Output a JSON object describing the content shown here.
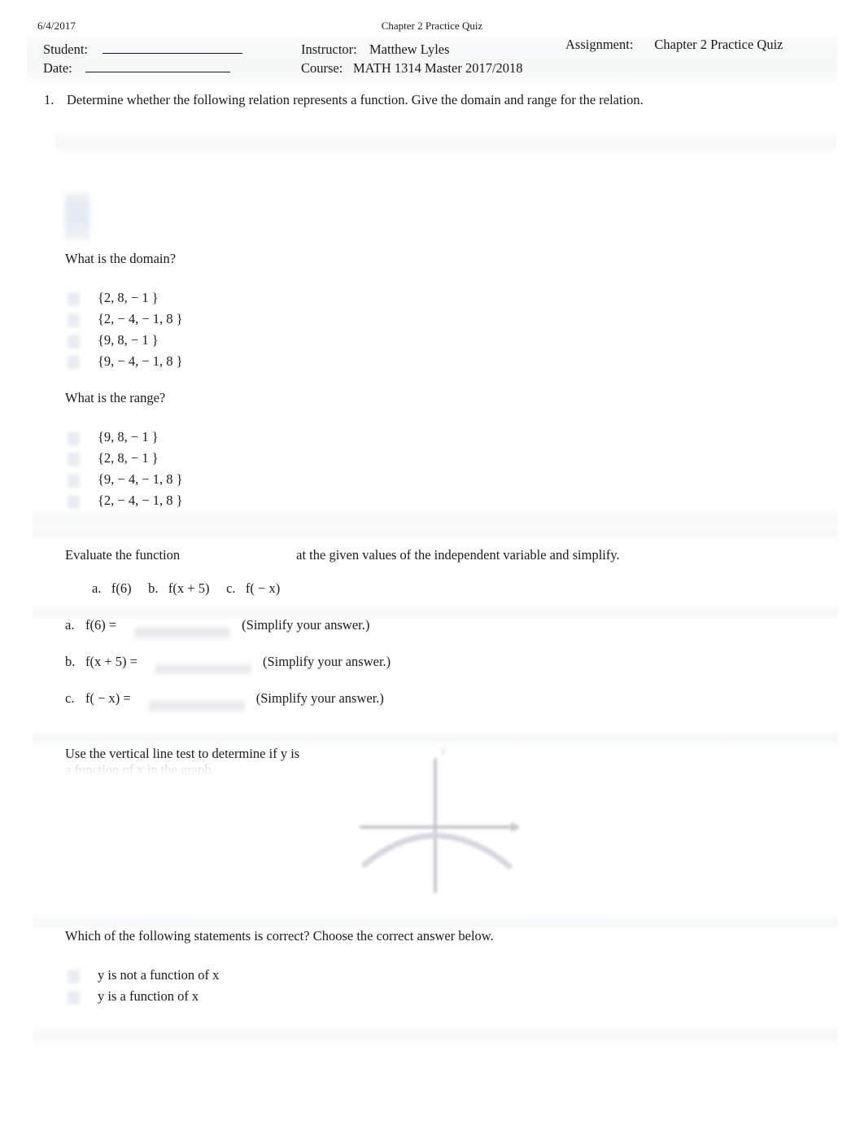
{
  "page": {
    "date": "6/4/2017",
    "doc_title": "Chapter 2 Practice Quiz"
  },
  "info_band": {
    "student_label": "Student:",
    "date_label": "Date:",
    "student_value": "",
    "date_value": "",
    "instructor_label": "Instructor:",
    "instructor_value": "Matthew Lyles",
    "course_label": "Course:",
    "course_value": "MATH 1314 Master 2017/2018",
    "assignment_label": "Assignment:",
    "assignment_value": "Chapter 2 Practice Quiz"
  },
  "question": {
    "number": "1.",
    "stem": "Determine whether the following relation represents a function. Give the domain and range for the relation."
  },
  "domain_section": {
    "prompt": "What is the domain?",
    "choices": [
      "{2, 8, − 1 }",
      "{2, − 4, − 1, 8 }",
      "{9, 8, − 1 }",
      "{9, − 4, − 1, 8 }"
    ]
  },
  "range_section": {
    "prompt": "What is the range?",
    "choices": [
      "{9, 8, − 1 }",
      "{2, 8, − 1 }",
      "{9, − 4, − 1, 8 }",
      "{2, − 4, − 1, 8 }"
    ]
  },
  "evaluate_section": {
    "intro_before": "Evaluate the function",
    "intro_after": "at the given values of the independent variable and simplify.",
    "parts_line": "a.  f(6)  b.  f(x + 5)  c.  f( − x)",
    "answers": [
      {
        "tag": "a.",
        "expr": "f(6) =",
        "hint": "(Simplify your answer.)"
      },
      {
        "tag": "b.",
        "expr": "f(x + 5) =",
        "hint": "(Simplify your answer.)"
      },
      {
        "tag": "c.",
        "expr": "f( − x) =",
        "hint": "(Simplify your answer.)"
      }
    ]
  },
  "vertical_line_test": {
    "line1": "Use the vertical line test to determine if y is",
    "line2": "a function of x in the graph.",
    "graph_y_label": "y",
    "final_prompt": "Which of the following statements is correct? Choose the correct answer below.",
    "choices": [
      "y is not a function of x",
      "y is a function of x"
    ]
  }
}
